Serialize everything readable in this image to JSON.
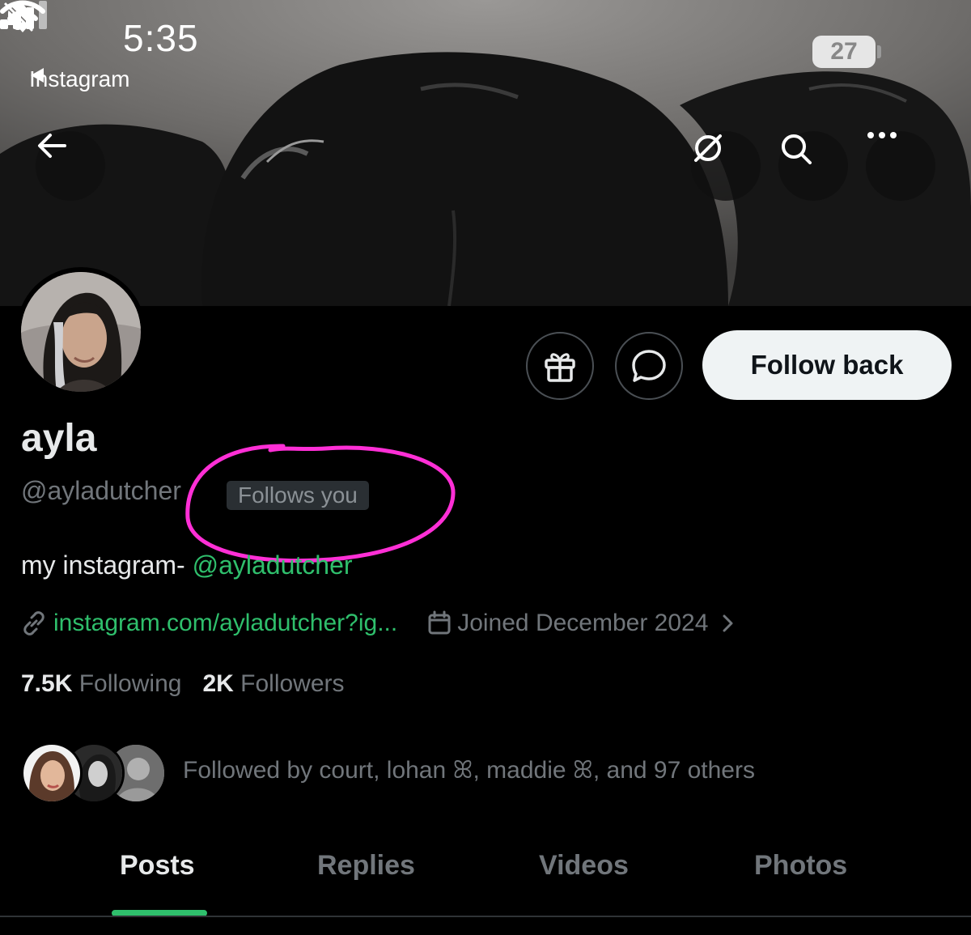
{
  "status_bar": {
    "time": "5:35",
    "back_app": "Instagram",
    "battery": "27"
  },
  "profile": {
    "display_name": "ayla",
    "handle": "@ayladutcher",
    "follows_you": "Follows you",
    "bio_prefix": "my instagram- ",
    "bio_mention": "@ayladutcher",
    "link": "instagram.com/ayladutcher?ig...",
    "joined": "Joined December 2024",
    "following_count": "7.5K",
    "following_label": "Following",
    "followers_count": "2K",
    "followers_label": "Followers",
    "followed_by": "Followed by court, lohan ꕤ, maddie ꕤ, and 97 others"
  },
  "actions": {
    "follow_back": "Follow back"
  },
  "tabs": [
    {
      "label": "Posts",
      "active": true
    },
    {
      "label": "Replies",
      "active": false
    },
    {
      "label": "Videos",
      "active": false
    },
    {
      "label": "Photos",
      "active": false
    }
  ],
  "colors": {
    "accent_green": "#2fbf6c",
    "highlight_pink": "#ff2fd6",
    "muted_text": "#71767b"
  },
  "icons": [
    "bell-slash-icon",
    "back-arrow-icon",
    "grok-icon",
    "search-icon",
    "more-icon",
    "gift-icon",
    "message-icon",
    "link-icon",
    "calendar-icon",
    "chevron-right-icon"
  ]
}
